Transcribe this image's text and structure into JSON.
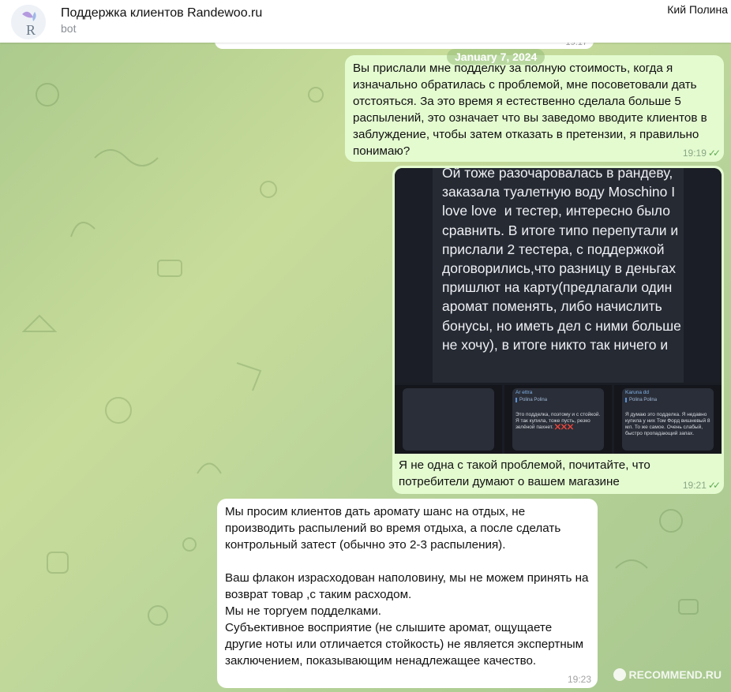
{
  "header": {
    "title": "Поддержка клиентов Randewoo.ru",
    "subtitle": "bot",
    "user": "Кий Полина",
    "avatar_letter": "R"
  },
  "previous_message": {
    "time": "19:17"
  },
  "date_label": "January 7, 2024",
  "messages": [
    {
      "direction": "out",
      "text": "Вы прислали мне подделку за полную стоимость, когда я изначально обратилась с проблемой, мне посоветовали дать отстояться. За это время я естественно сделала больше 5 распылений, это означает что вы заведомо вводите клиентов в заблуждение, чтобы затем отказать в претензии, я правильно понимаю?",
      "time": "19:19",
      "read": true
    },
    {
      "direction": "out",
      "has_media": true,
      "media_main_text": "Ой тоже разочаровалась в рандеву, заказала туалетную воду Moschino I love love  и тестер, интересно было сравнить. В итоге типо перепутали и прислали 2 тестера, с поддержкой договорились,что разницу в деньгах пришлют на карту(предлагали один аромат поменять, либо начислить бонусы, но иметь дел с ними больше не хочу), в итоге никто так ничего и",
      "thumbs": [
        {
          "name": "",
          "quote": "",
          "body": ""
        },
        {
          "name": "Ar ettra",
          "quote": "Polina Polina",
          "body": "Это подделка, поэтому и с стойкой. Я так купила, тоже пусть, резко зелёной пахнет. ❌❌❌"
        },
        {
          "name": "Karuna dd",
          "quote": "Polina Polina",
          "body": "Я думаю это подделка. Я недавно купила у них Том Форд вишневый 8 мл. То же самое. Очень слабый, быстро пропадающий запах."
        }
      ],
      "text": "Я не одна с такой проблемой, почитайте, что потребители думают о вашем магазине",
      "time": "19:21",
      "read": true
    },
    {
      "direction": "in",
      "text": "Мы просим клиентов дать аромату шанс на отдых, не производить распылений во время отдыха, а после сделать контрольный затест (обычно это 2-3 распыления).\n\nВаш флакон израсходован наполовину, мы не можем принять на возврат товар ,с таким расходом.\nМы не торгуем подделками.\nСубъективное восприятие (не слышите аромат, ощущаете другие ноты или отличается стойкость) не является экспертным заключением, показывающим ненадлежащее качество.",
      "time": "19:23"
    }
  ],
  "watermark": "RECOMMEND.RU",
  "colors": {
    "outgoing": "#e4fbd0",
    "incoming": "#ffffff",
    "accent": "#62ac55"
  }
}
